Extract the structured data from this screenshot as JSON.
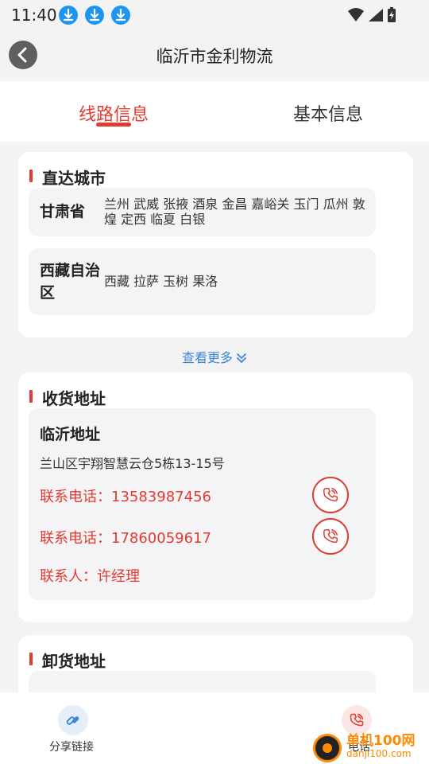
{
  "status": {
    "time": "11:40",
    "icons": [
      "download-icon",
      "download-icon",
      "download-icon",
      "wifi-icon",
      "signal-icon",
      "battery-charging-icon"
    ]
  },
  "header": {
    "title": "临沂市金利物流"
  },
  "tabs": [
    {
      "label": "线路信息",
      "active": true
    },
    {
      "label": "基本信息",
      "active": false
    }
  ],
  "direct_cities": {
    "title": "直达城市",
    "provinces": [
      {
        "name": "甘肃省",
        "cities": "兰州 武威 张掖 酒泉 金昌 嘉峪关 玉门 瓜州 敦煌 定西 临夏 白银"
      },
      {
        "name": "西藏自治区",
        "name_line1": "西藏自治",
        "name_line2": "区",
        "cities": "西藏 拉萨 玉树 果洛"
      }
    ],
    "see_more": "查看更多"
  },
  "receive_address": {
    "title": "收货地址",
    "place_name": "临沂地址",
    "address": "兰山区宇翔智慧云仓5栋13-15号",
    "phone_label": "联系电话：",
    "phones": [
      "13583987456",
      "17860059617"
    ],
    "contact_label": "联系人：",
    "contact_name": "许经理"
  },
  "unload_address": {
    "title": "卸货地址"
  },
  "bottom_bar": {
    "share_label": "分享链接",
    "call_label": "电话"
  },
  "watermark": {
    "text1": "单机100网",
    "text2": "danji100.com"
  },
  "colors": {
    "accent": "#e23b32",
    "link": "#3b87d8",
    "background": "#f3f3f3"
  }
}
